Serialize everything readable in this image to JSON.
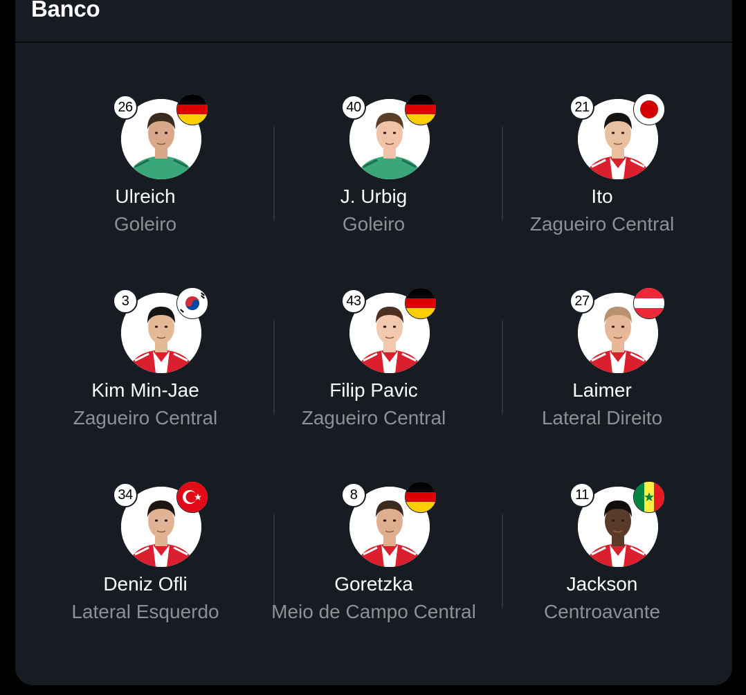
{
  "header": {
    "title": "Banco"
  },
  "players": [
    {
      "number": "26",
      "name": "Ulreich",
      "position": "Goleiro",
      "flag": "germany-flag-icon",
      "kit": "goalkeeper",
      "skin": "#d9a88a",
      "hair": "#3b2a1e"
    },
    {
      "number": "40",
      "name": "J. Urbig",
      "position": "Goleiro",
      "flag": "germany-flag-icon",
      "kit": "goalkeeper",
      "skin": "#f0c2a8",
      "hair": "#5a3e2a"
    },
    {
      "number": "21",
      "name": "Ito",
      "position": "Zagueiro Central",
      "flag": "japan-flag-icon",
      "kit": "home",
      "skin": "#e8c0a0",
      "hair": "#141414"
    },
    {
      "number": "3",
      "name": "Kim Min-Jae",
      "position": "Zagueiro Central",
      "flag": "south-korea-flag-icon",
      "kit": "home",
      "skin": "#e4b996",
      "hair": "#141414"
    },
    {
      "number": "43",
      "name": "Filip Pavic",
      "position": "Zagueiro Central",
      "flag": "germany-flag-icon",
      "kit": "home",
      "skin": "#f2c9ae",
      "hair": "#4a3122"
    },
    {
      "number": "27",
      "name": "Laimer",
      "position": "Lateral Direito",
      "flag": "austria-flag-icon",
      "kit": "home",
      "skin": "#e7b79a",
      "hair": "#b89270"
    },
    {
      "number": "34",
      "name": "Deniz Ofli",
      "position": "Lateral Esquerdo",
      "flag": "turkey-flag-icon",
      "kit": "home",
      "skin": "#e2b294",
      "hair": "#1e1612"
    },
    {
      "number": "8",
      "name": "Goretzka",
      "position": "Meio de Campo Central",
      "flag": "germany-flag-icon",
      "kit": "home",
      "skin": "#dfae8e",
      "hair": "#3c2a1e"
    },
    {
      "number": "11",
      "name": "Jackson",
      "position": "Centroavante",
      "flag": "senegal-flag-icon",
      "kit": "home",
      "skin": "#5a3a2a",
      "hair": "#120c0a"
    }
  ],
  "colors": {
    "card_bg": "#161c21",
    "name_text": "#ffffff",
    "position_text": "#8b9196",
    "divider": "#2c343a",
    "home_kit_red": "#dc1f2e",
    "goalkeeper_green": "#3aa77a"
  }
}
